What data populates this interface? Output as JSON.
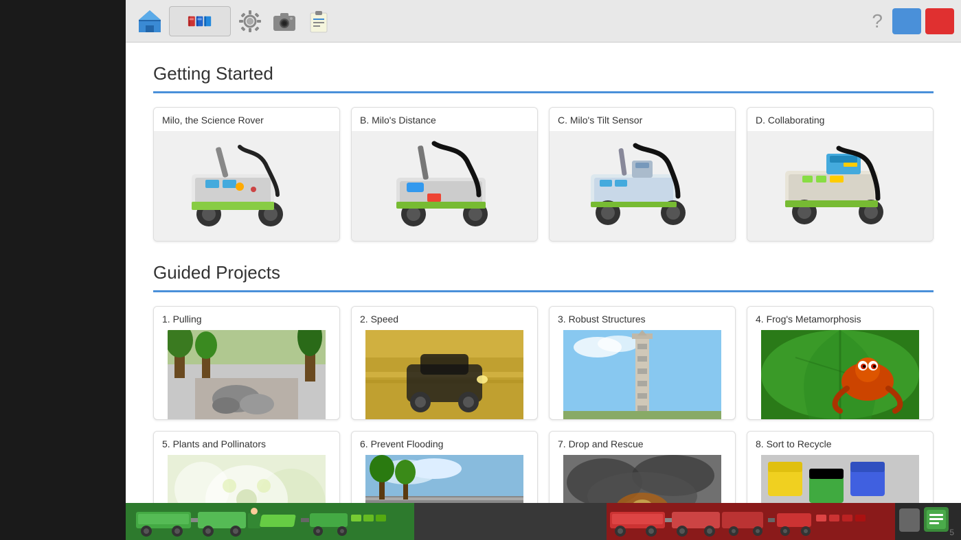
{
  "toolbar": {
    "home_icon": "home",
    "book_icon": "book",
    "gear_icon": "gear",
    "camera_icon": "camera",
    "clipboard_icon": "clipboard",
    "help_icon": "?",
    "page_number": "5"
  },
  "getting_started": {
    "title": "Getting Started",
    "cards": [
      {
        "label": "Milo, the Science Rover",
        "id": "milo-rover"
      },
      {
        "label": "B. Milo's Distance",
        "id": "milos-distance"
      },
      {
        "label": "C. Milo's Tilt Sensor",
        "id": "milos-tilt"
      },
      {
        "label": "D. Collaborating",
        "id": "collaborating"
      }
    ]
  },
  "guided_projects": {
    "title": "Guided Projects",
    "cards": [
      {
        "label": "1. Pulling",
        "id": "pulling"
      },
      {
        "label": "2. Speed",
        "id": "speed"
      },
      {
        "label": "3. Robust Structures",
        "id": "robust-structures"
      },
      {
        "label": "4. Frog's Metamorphosis",
        "id": "frogs-metamorphosis"
      },
      {
        "label": "5. Plants and Pollinators",
        "id": "plants-pollinators"
      },
      {
        "label": "6. Prevent Flooding",
        "id": "prevent-flooding"
      },
      {
        "label": "7. Drop and Rescue",
        "id": "drop-rescue"
      },
      {
        "label": "8. Sort to Recycle",
        "id": "sort-recycle"
      }
    ]
  }
}
